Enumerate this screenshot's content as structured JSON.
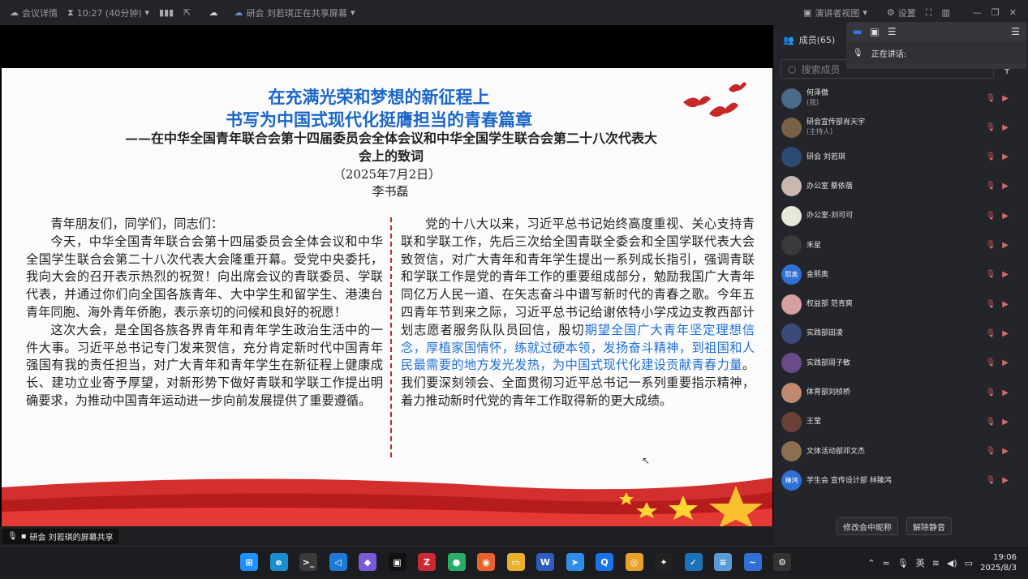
{
  "topbar": {
    "meeting_info": "会议详情",
    "timer": "10:27 (40分钟)",
    "sharing_notice": "研会 刘若琪正在共享屏幕",
    "speaker_view": "演讲者视图",
    "settings": "设置"
  },
  "slide": {
    "title_line1": "在充满光荣和梦想的新征程上",
    "title_line2": "书写为中国式现代化挺膺担当的青春篇章",
    "subtitle": "——在中华全国青年联合会第十四届委员会全体会议和中华全国学生联合会第二十八次代表大会上的致词",
    "date": "（2025年7月2日）",
    "author": "李书磊",
    "left_greeting": "青年朋友们，同学们，同志们：",
    "left_p1": "今天，中华全国青年联合会第十四届委员会全体会议和中华全国学生联合会第二十八次代表大会隆重开幕。受党中央委托，我向大会的召开表示热烈的祝贺！向出席会议的青联委员、学联代表，并通过你们向全国各族青年、大中学生和留学生、港澳台青年同胞、海外青年侨胞，表示亲切的问候和良好的祝愿！",
    "left_p2": "这次大会，是全国各族各界青年和青年学生政治生活中的一件大事。习近平总书记专门发来贺信，充分肯定新时代中国青年强国有我的责任担当，对广大青年和青年学生在新征程上健康成长、建功立业寄予厚望，对新形势下做好青联和学联工作提出明确要求，为推动中国青年运动进一步向前发展提供了重要遵循。",
    "right_p1_a": "党的十八大以来，习近平总书记始终高度重视、关心支持青联和学联工作，先后三次给全国青联全委会和全国学联代表大会致贺信，对广大青年和青年学生提出一系列成长指引，强调青联和学联工作是党的青年工作的重要组成部分，勉励我国广大青年同亿万人民一道、在矢志奋斗中谱写新时代的青春之歌。今年五四青年节到来之际，习近平总书记给谢依特小学戍边支教西部计划志愿者服务队队员回信，殷切",
    "right_p1_b": "期望全国广大青年坚定理想信念，厚植家国情怀，练就过硬本领，发扬奋斗精神，到祖国和人民最需要的地方发光发热，为中国式现代化建设贡献青春力量",
    "right_p1_c": "。我们要深刻领会、全面贯彻习近平总书记一系列重要指示精神，着力推动新时代党的青年工作取得新的更大成绩。"
  },
  "status": {
    "share_label": "研会 刘若琪的屏幕共享"
  },
  "panel": {
    "members_title": "成员(65)",
    "speaking_label": "正在讲话:",
    "search_placeholder": "搜索成员",
    "members": [
      {
        "name": "何泽傲",
        "role": "(我)",
        "color": "#4a6a8a",
        "initial": ""
      },
      {
        "name": "研会宣传部肖天宇",
        "role": "(主持人)",
        "color": "#7a6048",
        "initial": ""
      },
      {
        "name": "研会 刘若琪",
        "role": "",
        "color": "#2d4a72",
        "initial": ""
      },
      {
        "name": "办公室 蔡依蓓",
        "role": "",
        "color": "#c9b8b0",
        "initial": ""
      },
      {
        "name": "办公室-刘可可",
        "role": "",
        "color": "#e8e8d8",
        "initial": ""
      },
      {
        "name": "禾星",
        "role": "",
        "color": "#3a3a3a",
        "initial": ""
      },
      {
        "name": "金熙奥",
        "role": "",
        "color": "#2f6fd6",
        "initial": "熙奥"
      },
      {
        "name": "权益部 范青爽",
        "role": "",
        "color": "#d4a0a0",
        "initial": ""
      },
      {
        "name": "实践部田凌",
        "role": "",
        "color": "#3a4a7a",
        "initial": ""
      },
      {
        "name": "实践部周子敏",
        "role": "",
        "color": "#6a4a8a",
        "initial": ""
      },
      {
        "name": "体育部刘桢桥",
        "role": "",
        "color": "#c08a70",
        "initial": ""
      },
      {
        "name": "王莹",
        "role": "",
        "color": "#6a4038",
        "initial": ""
      },
      {
        "name": "文体活动部邓文杰",
        "role": "",
        "color": "#8a7050",
        "initial": ""
      },
      {
        "name": "学生会 宣传设计部 林臻鸿",
        "role": "",
        "color": "#2f6fd6",
        "initial": "臻鸿"
      }
    ],
    "rename_button": "修改会中昵称",
    "unmute_button": "解除静音"
  },
  "tray": {
    "ime": "英",
    "time": "19:06",
    "date": "2025/8/3"
  },
  "taskbar_apps": [
    {
      "name": "windows-start",
      "color": "#1e90ff",
      "glyph": "⊞"
    },
    {
      "name": "edge",
      "color": "#1a8fd0",
      "glyph": "e"
    },
    {
      "name": "terminal",
      "color": "#3a3a3a",
      "glyph": ">_"
    },
    {
      "name": "vscode",
      "color": "#1e7ad6",
      "glyph": "◁"
    },
    {
      "name": "app-purple",
      "color": "#7a5ad6",
      "glyph": "◆"
    },
    {
      "name": "app-black",
      "color": "#111111",
      "glyph": "▣"
    },
    {
      "name": "zotero",
      "color": "#cc2936",
      "glyph": "Z"
    },
    {
      "name": "wechat",
      "color": "#2aae67",
      "glyph": "●"
    },
    {
      "name": "firefox",
      "color": "#e8632b",
      "glyph": "◉"
    },
    {
      "name": "file-explorer",
      "color": "#e8b02b",
      "glyph": "▭"
    },
    {
      "name": "word",
      "color": "#2b5cbe",
      "glyph": "W"
    },
    {
      "name": "feishu",
      "color": "#2f8ee8",
      "glyph": "➤"
    },
    {
      "name": "app-blue-q",
      "color": "#1a73e8",
      "glyph": "Q"
    },
    {
      "name": "chrome",
      "color": "#e8a22b",
      "glyph": "◎"
    },
    {
      "name": "qq",
      "color": "#222222",
      "glyph": "✦"
    },
    {
      "name": "app-check",
      "color": "#1a73b8",
      "glyph": "✓"
    },
    {
      "name": "notepad",
      "color": "#5a9ad6",
      "glyph": "≡"
    },
    {
      "name": "tencent-meeting",
      "color": "#2f6fd6",
      "glyph": "~"
    },
    {
      "name": "app-gear",
      "color": "#333333",
      "glyph": "⚙"
    }
  ]
}
